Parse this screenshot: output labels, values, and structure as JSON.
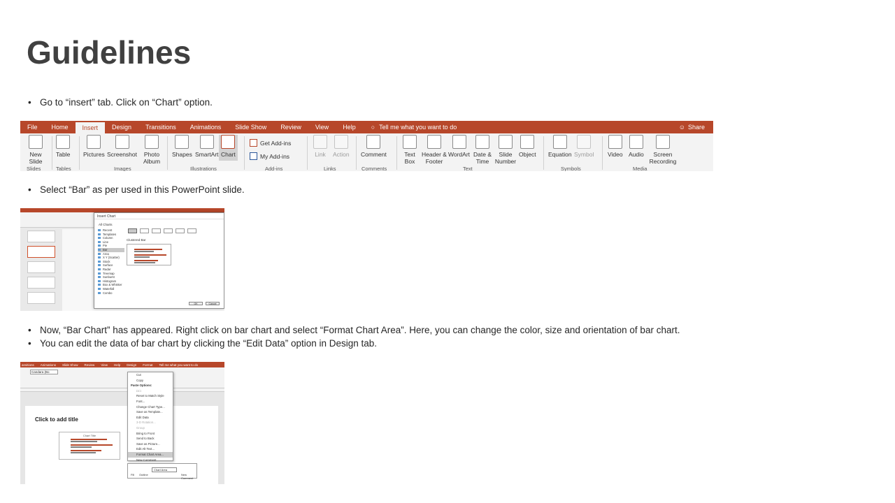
{
  "slide": {
    "title": "Guidelines",
    "bullets": [
      "Go to “insert” tab. Click on “Chart” option.",
      "Select “Bar” as per used in this PowerPoint  slide.",
      "Now, “Bar Chart” has appeared. Right click on bar chart and select “Format Chart Area”. Here, you can change the color, size and orientation of bar chart.",
      "You can edit the data of bar chart by clicking the “Edit Data” option in Design tab."
    ]
  },
  "ribbon": {
    "tabs": [
      "File",
      "Home",
      "Insert",
      "Design",
      "Transitions",
      "Animations",
      "Slide Show",
      "Review",
      "View",
      "Help"
    ],
    "tell_me": "Tell me what you want to do",
    "share": "Share",
    "buttons": {
      "new_slide": "New Slide",
      "table": "Table",
      "pictures": "Pictures",
      "screenshot": "Screenshot",
      "photo_album": "Photo Album",
      "shapes": "Shapes",
      "smartart": "SmartArt",
      "chart": "Chart",
      "get_addins": "Get Add-ins",
      "my_addins": "My Add-ins",
      "link": "Link",
      "action": "Action",
      "comment": "Comment",
      "text_box": "Text Box",
      "header_footer": "Header & Footer",
      "wordart": "WordArt",
      "date_time": "Date & Time",
      "slide_number": "Slide Number",
      "object": "Object",
      "equation": "Equation",
      "symbol": "Symbol",
      "video": "Video",
      "audio": "Audio",
      "screen_recording": "Screen Recording"
    },
    "groups": [
      "Slides",
      "Tables",
      "Images",
      "Illustrations",
      "Add-ins",
      "Links",
      "Comments",
      "Text",
      "Symbols",
      "Media"
    ]
  },
  "insert_chart_dialog": {
    "title": "Insert Chart",
    "all_charts": "All Charts",
    "types": [
      "Recent",
      "Templates",
      "Column",
      "Line",
      "Pie",
      "Bar",
      "Area",
      "X Y (Scatter)",
      "Stock",
      "Surface",
      "Radar",
      "Treemap",
      "Sunburst",
      "Histogram",
      "Box & Whisker",
      "Waterfall",
      "Combo"
    ],
    "selected_type": "Bar",
    "subtype_name": "Clustered Bar",
    "ok": "OK",
    "cancel": "Cancel"
  },
  "format_shot": {
    "tabs": [
      "ansitions",
      "Animations",
      "Slide Show",
      "Review",
      "View",
      "Help",
      "Design",
      "Format",
      "Tell me what you want to do"
    ],
    "font_name": "Candara (Bo",
    "slide_title_placeholder": "Click to add title",
    "chart_title": "Chart Title",
    "context_menu": {
      "items": [
        "Cut",
        "Copy",
        "Paste Options:",
        "Reset to Match Style",
        "Font...",
        "Change Chart Type...",
        "Save as Template...",
        "Edit Data",
        "3-D Rotation...",
        "Group",
        "Bring to Front",
        "Send to Back",
        "Save as Picture...",
        "Edit Alt Text...",
        "Format Chart Area...",
        "New Comment"
      ],
      "highlighted": "Format Chart Area...",
      "disabled": [
        "3-D Rotation...",
        "Group"
      ]
    },
    "mini_toolbar": {
      "fill": "Fill",
      "outline": "Outline",
      "chart_area": "Chart Area",
      "new_comment": "New Comment"
    }
  },
  "colors": {
    "accent": "#b7472a",
    "title": "#404040",
    "text": "#262626"
  }
}
